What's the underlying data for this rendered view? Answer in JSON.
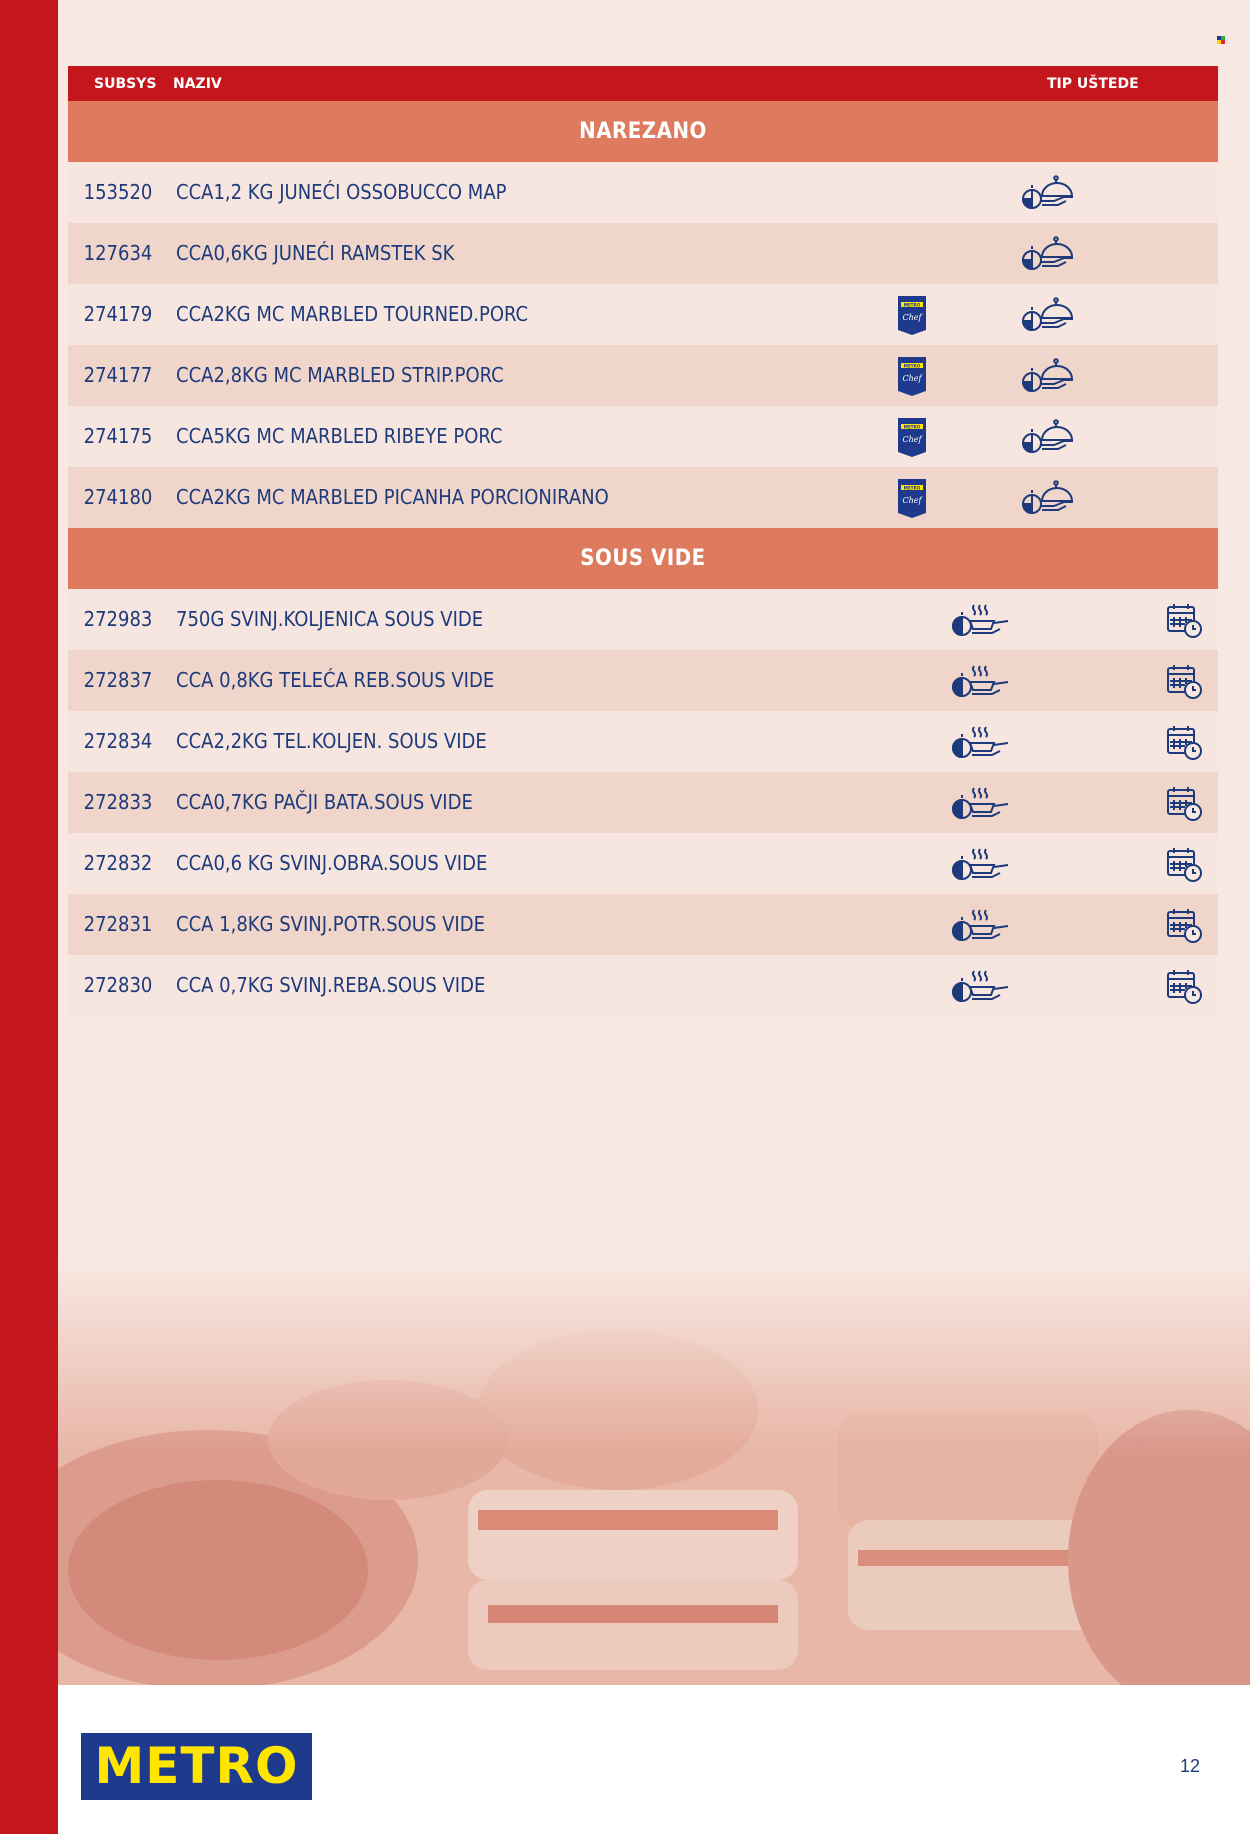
{
  "header": {
    "subsys_label": "SUBSYS",
    "naziv_label": "NAZIV",
    "tip_label": "TIP UŠTEDE"
  },
  "sections": [
    {
      "title": "NAREZANO",
      "rows": [
        {
          "code": "153520",
          "name": "CCA1,2 KG JUNEĆI OSSOBUCCO MAP",
          "brand": null,
          "icons": [
            "dome-timer-icon"
          ]
        },
        {
          "code": "127634",
          "name": "CCA0,6KG JUNEĆI RAMSTEK SK",
          "brand": null,
          "icons": [
            "dome-timer-icon"
          ]
        },
        {
          "code": "274179",
          "name": "CCA2KG MC MARBLED TOURNED.PORC",
          "brand": "METRO Chef",
          "icons": [
            "dome-timer-icon"
          ]
        },
        {
          "code": "274177",
          "name": "CCA2,8KG MC MARBLED STRIP.PORC",
          "brand": "METRO Chef",
          "icons": [
            "dome-timer-icon"
          ]
        },
        {
          "code": "274175",
          "name": "CCA5KG MC MARBLED RIBEYE PORC",
          "brand": "METRO Chef",
          "icons": [
            "dome-timer-icon"
          ]
        },
        {
          "code": "274180",
          "name": "CCA2KG MC MARBLED PICANHA PORCIONIRANO",
          "brand": "METRO Chef",
          "icons": [
            "dome-timer-icon"
          ]
        }
      ]
    },
    {
      "title": "SOUS VIDE",
      "rows": [
        {
          "code": "272983",
          "name": "750G SVINJ.KOLJENICA SOUS VIDE",
          "brand": null,
          "icons": [
            "pan-timer-icon",
            "calendar-clock-icon"
          ]
        },
        {
          "code": "272837",
          "name": "CCA 0,8KG TELEĆA REB.SOUS VIDE",
          "brand": null,
          "icons": [
            "pan-timer-icon",
            "calendar-clock-icon"
          ]
        },
        {
          "code": "272834",
          "name": "CCA2,2KG TEL.KOLJEN. SOUS VIDE",
          "brand": null,
          "icons": [
            "pan-timer-icon",
            "calendar-clock-icon"
          ]
        },
        {
          "code": "272833",
          "name": "CCA0,7KG PAČJI BATA.SOUS VIDE",
          "brand": null,
          "icons": [
            "pan-timer-icon",
            "calendar-clock-icon"
          ]
        },
        {
          "code": "272832",
          "name": "CCA0,6 KG SVINJ.OBRA.SOUS VIDE",
          "brand": null,
          "icons": [
            "pan-timer-icon",
            "calendar-clock-icon"
          ]
        },
        {
          "code": "272831",
          "name": "CCA 1,8KG SVINJ.POTR.SOUS VIDE",
          "brand": null,
          "icons": [
            "pan-timer-icon",
            "calendar-clock-icon"
          ]
        },
        {
          "code": "272830",
          "name": "CCA 0,7KG SVINJ.REBA.SOUS VIDE",
          "brand": null,
          "icons": [
            "pan-timer-icon",
            "calendar-clock-icon"
          ]
        }
      ]
    }
  ],
  "footer": {
    "logo_text": "METRO",
    "page_number": "12"
  },
  "colors": {
    "brand_red": "#c4171d",
    "section_salmon": "#de7b5f",
    "text_navy": "#1d3a7a",
    "logo_blue": "#1e3a8c",
    "logo_yellow": "#ffe500"
  }
}
